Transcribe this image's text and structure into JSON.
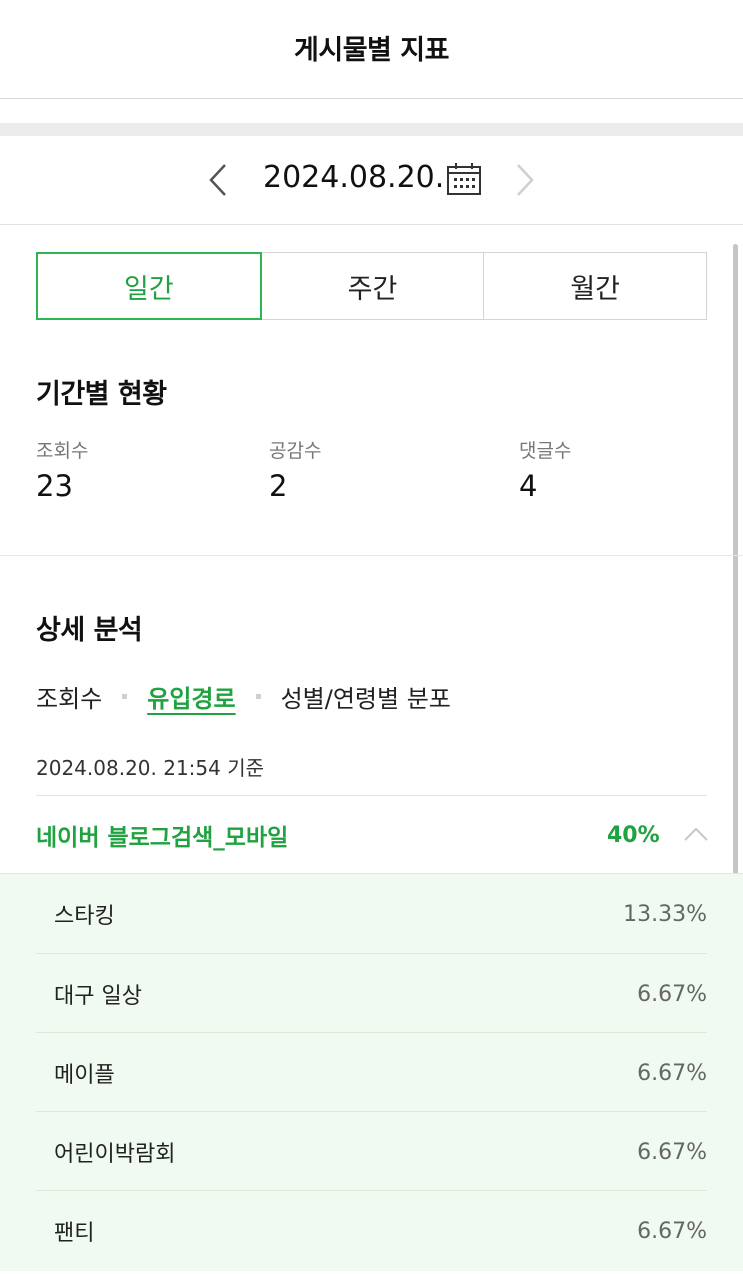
{
  "header": {
    "title": "게시물별 지표"
  },
  "date_nav": {
    "date": "2024.08.20.",
    "prev_icon": "chevron-left-icon",
    "next_icon": "chevron-right-icon",
    "calendar_icon": "calendar-icon"
  },
  "period_tabs": [
    {
      "label": "일간",
      "active": true
    },
    {
      "label": "주간",
      "active": false
    },
    {
      "label": "월간",
      "active": false
    }
  ],
  "period_status": {
    "title": "기간별 현황",
    "stats": [
      {
        "label": "조회수",
        "value": "23"
      },
      {
        "label": "공감수",
        "value": "2"
      },
      {
        "label": "댓글수",
        "value": "4"
      }
    ]
  },
  "detail_analysis": {
    "title": "상세 분석",
    "subtabs": [
      {
        "label": "조회수",
        "active": false
      },
      {
        "label": "유입경로",
        "active": true
      },
      {
        "label": "성별/연령별 분포",
        "active": false
      }
    ],
    "basis_time": "2024.08.20. 21:54 기준",
    "source": {
      "name": "네이버 블로그검색_모바일",
      "percent": "40%",
      "expanded": true
    },
    "keywords": [
      {
        "name": "스타킹",
        "percent": "13.33%"
      },
      {
        "name": "대구 일상",
        "percent": "6.67%"
      },
      {
        "name": "메이플",
        "percent": "6.67%"
      },
      {
        "name": "어린이박람회",
        "percent": "6.67%"
      },
      {
        "name": "팬티",
        "percent": "6.67%"
      }
    ]
  },
  "colors": {
    "accent": "#1fa23f",
    "accent_border": "#2db551",
    "detail_bg": "#f1faf1"
  }
}
